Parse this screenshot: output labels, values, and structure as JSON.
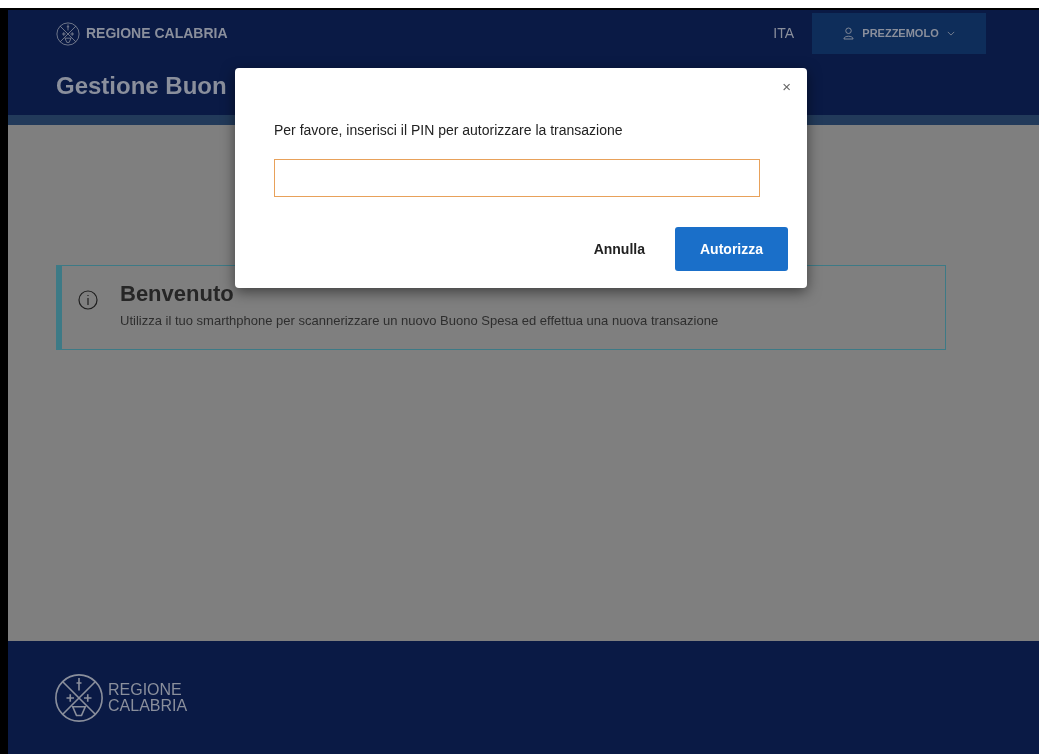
{
  "header": {
    "brand": "REGIONE CALABRIA",
    "language": "ITA",
    "user": "PREZZEMOLO"
  },
  "page_title": "Gestione Buon",
  "alert": {
    "title": "Benvenuto",
    "message": "Utilizza il tuo smarthphone per scannerizzare un nuovo Buono Spesa ed effettua una nuova transazione"
  },
  "footer": {
    "brand_line_1": "REGIONE",
    "brand_line_2": "CALABRIA"
  },
  "modal": {
    "close": "×",
    "prompt": "Per favore, inserisci il PIN per autorizzare la transazione",
    "buttons": [
      {
        "label": "Annulla",
        "kind": "secondary"
      },
      {
        "label": "Autorizza",
        "kind": "primary"
      }
    ]
  }
}
